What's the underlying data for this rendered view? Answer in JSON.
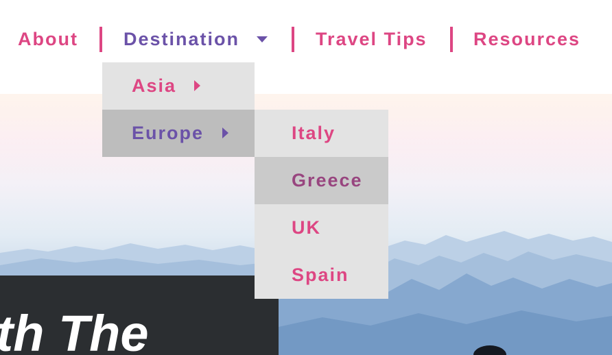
{
  "nav": {
    "items": [
      {
        "label": "About"
      },
      {
        "label": "Destination"
      },
      {
        "label": "Travel Tips"
      },
      {
        "label": "Resources"
      }
    ]
  },
  "dropdown": {
    "regions": [
      {
        "label": "Asia"
      },
      {
        "label": "Europe"
      }
    ],
    "europe_countries": [
      {
        "label": "Italy"
      },
      {
        "label": "Greece"
      },
      {
        "label": "UK"
      },
      {
        "label": "Spain"
      }
    ]
  },
  "hero": {
    "heading": "ith The"
  },
  "colors": {
    "link": "#dd4683",
    "active": "#6b52a8",
    "menu_bg": "#e3e3e3",
    "menu_hover": "#bdbdbd",
    "hero_band": "#2b2e31"
  }
}
